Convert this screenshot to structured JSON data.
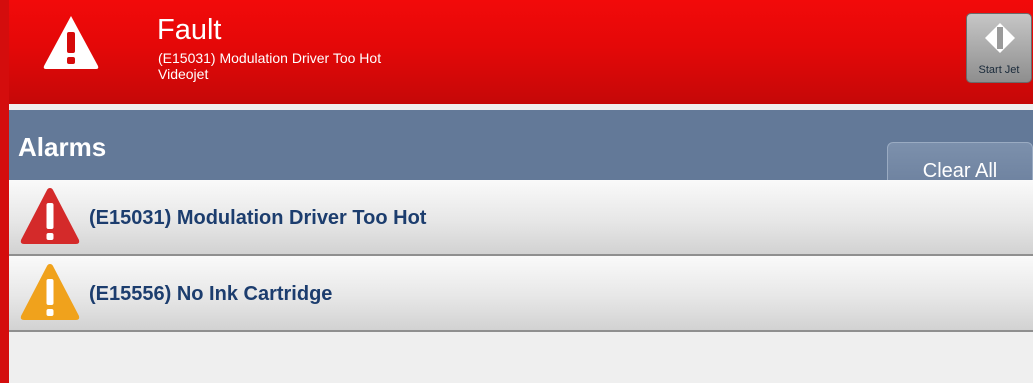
{
  "header": {
    "title": "Fault",
    "subtitle": "(E15031) Modulation Driver Too Hot",
    "source": "Videojet",
    "icon": "fault-warning-icon",
    "color": "#e40808"
  },
  "start_jet": {
    "label": "Start Jet",
    "icon": "start-jet-diamond-icon"
  },
  "alarms": {
    "title": "Alarms",
    "clear_all_label": "Clear All",
    "items": [
      {
        "text": "(E15031) Modulation Driver Too Hot",
        "severity": "fault",
        "icon": "red-warning-icon",
        "color": "#d42a2a"
      },
      {
        "text": "(E15556) No Ink Cartridge",
        "severity": "warning",
        "icon": "orange-warning-icon",
        "color": "#f0a21c"
      }
    ]
  }
}
